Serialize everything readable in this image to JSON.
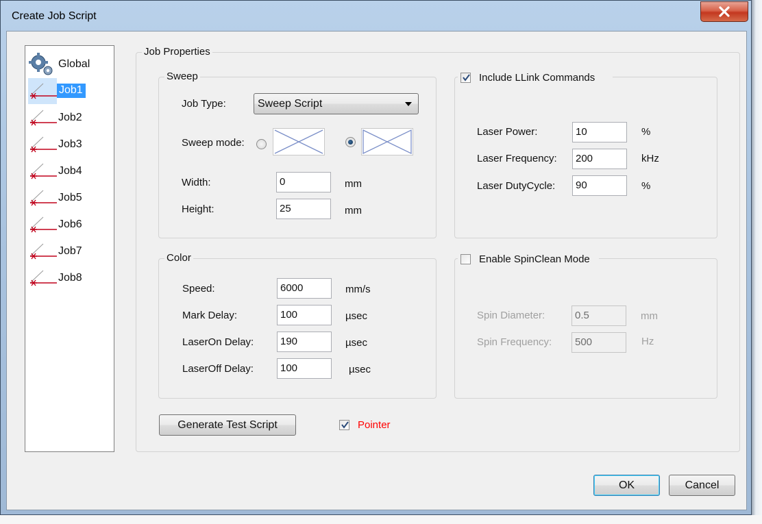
{
  "window": {
    "title": "Create Job Script"
  },
  "job_list": {
    "items": [
      {
        "label": "Global",
        "icon": "gears-icon",
        "selected": false
      },
      {
        "label": "Job1",
        "icon": "laser-beam-icon",
        "selected": true
      },
      {
        "label": "Job2",
        "icon": "laser-beam-icon",
        "selected": false
      },
      {
        "label": "Job3",
        "icon": "laser-beam-icon",
        "selected": false
      },
      {
        "label": "Job4",
        "icon": "laser-beam-icon",
        "selected": false
      },
      {
        "label": "Job5",
        "icon": "laser-beam-icon",
        "selected": false
      },
      {
        "label": "Job6",
        "icon": "laser-beam-icon",
        "selected": false
      },
      {
        "label": "Job7",
        "icon": "laser-beam-icon",
        "selected": false
      },
      {
        "label": "Job8",
        "icon": "laser-beam-icon",
        "selected": false
      }
    ]
  },
  "job_properties": {
    "label": "Job Properties",
    "sweep": {
      "label": "Sweep",
      "job_type_label": "Job Type:",
      "job_type_value": "Sweep Script",
      "sweep_mode_label": "Sweep mode:",
      "sweep_mode_selected": 2,
      "width_label": "Width:",
      "width_value": "0",
      "width_unit": "mm",
      "height_label": "Height:",
      "height_value": "25",
      "height_unit": "mm"
    },
    "color": {
      "label": "Color",
      "speed_label": "Speed:",
      "speed_value": "6000",
      "speed_unit": "mm/s",
      "mark_delay_label": "Mark Delay:",
      "mark_delay_value": "100",
      "mark_delay_unit": "µsec",
      "laseron_label": "LaserOn Delay:",
      "laseron_value": "190",
      "laseron_unit": "µsec",
      "laseroff_label": "LaserOff Delay:",
      "laseroff_value": "100",
      "laseroff_unit": "µsec"
    },
    "llink": {
      "label": "Include LLink Commands",
      "checked": true,
      "power_label": "Laser Power:",
      "power_value": "10",
      "power_unit": "%",
      "freq_label": "Laser Frequency:",
      "freq_value": "200",
      "freq_unit": "kHz",
      "duty_label": "Laser DutyCycle:",
      "duty_value": "90",
      "duty_unit": "%"
    },
    "spinclean": {
      "label": "Enable SpinClean Mode",
      "checked": false,
      "diameter_label": "Spin Diameter:",
      "diameter_value": "0.5",
      "diameter_unit": "mm",
      "frequency_label": "Spin Frequency:",
      "frequency_value": "500",
      "frequency_unit": "Hz"
    },
    "generate_button": "Generate Test Script",
    "pointer": {
      "label": "Pointer",
      "checked": true,
      "color": "#ff0000"
    }
  },
  "buttons": {
    "ok": "OK",
    "cancel": "Cancel"
  }
}
